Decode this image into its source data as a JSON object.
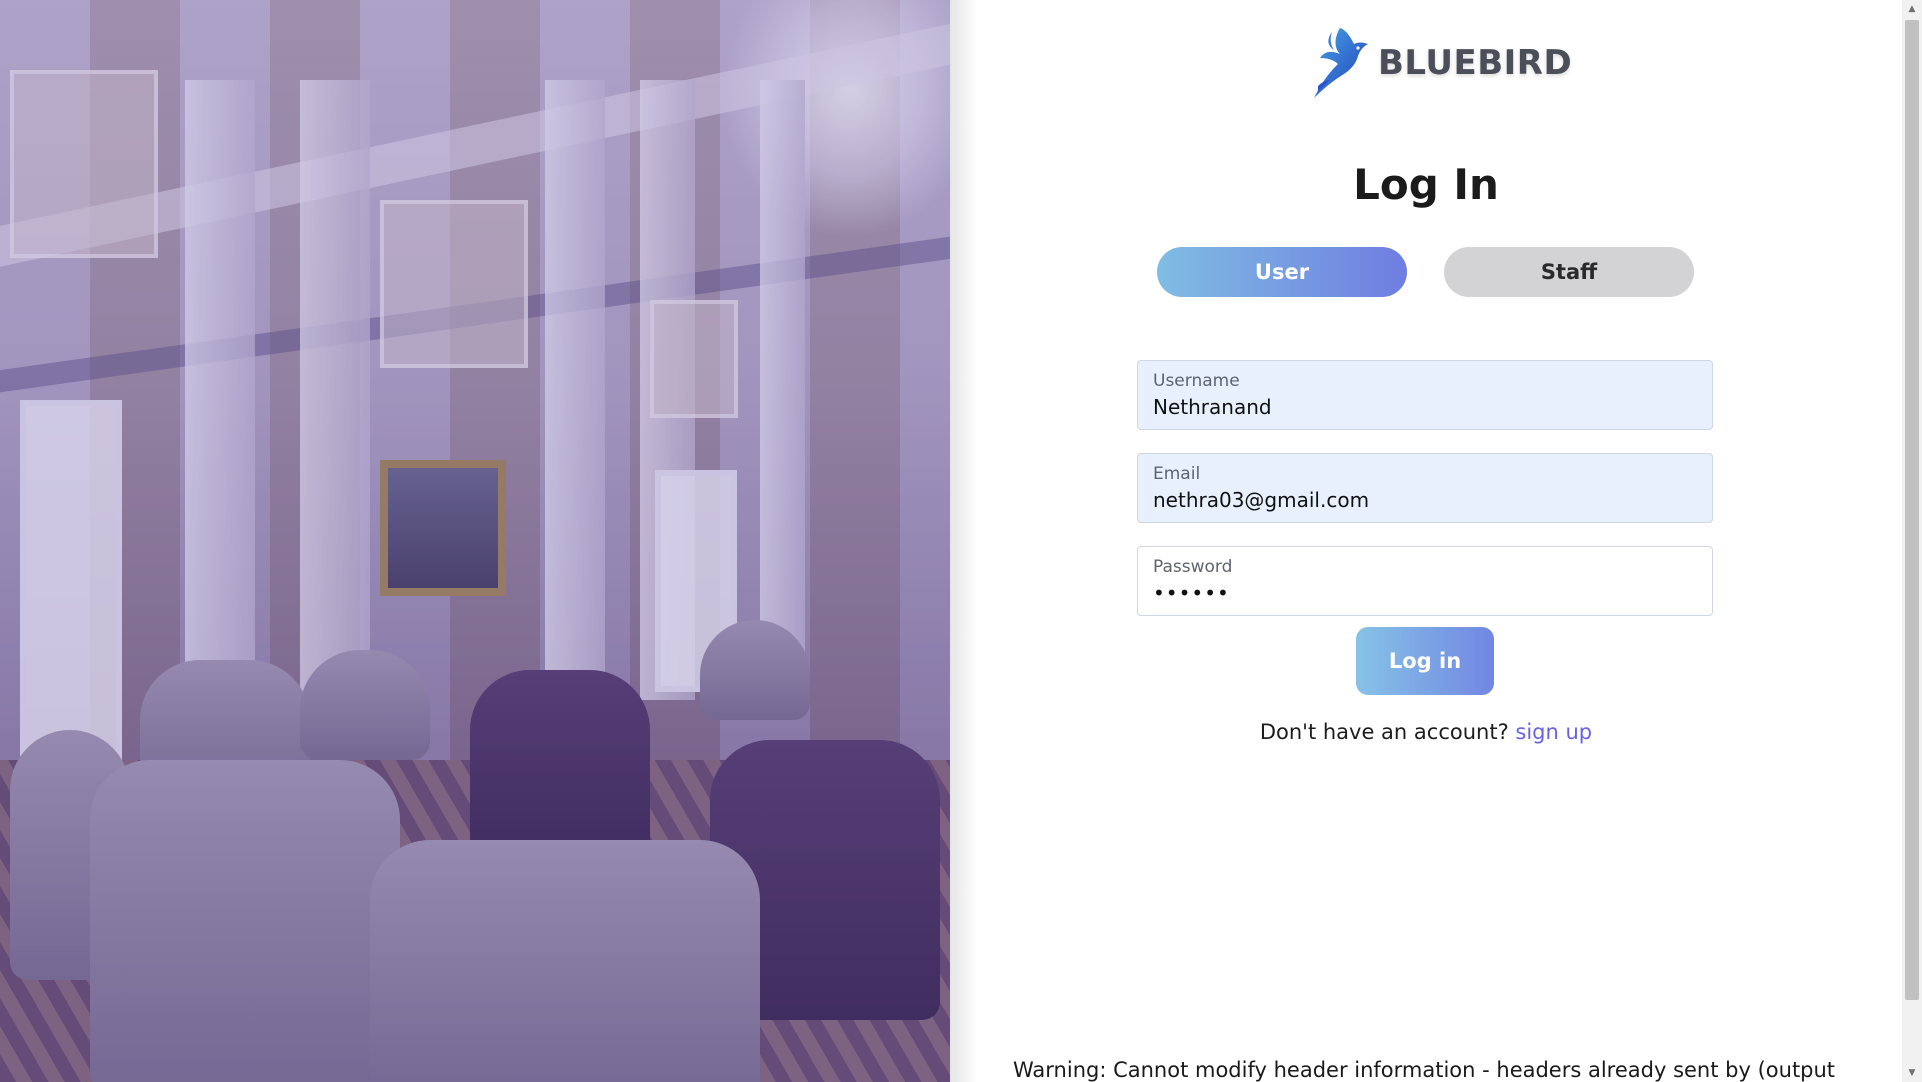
{
  "brand": {
    "name": "BLUEBIRD",
    "icon": "bluebird-logo-icon"
  },
  "login": {
    "title": "Log In",
    "roles": {
      "user_label": "User",
      "staff_label": "Staff",
      "selected": "User"
    },
    "fields": {
      "username": {
        "label": "Username",
        "value": "Nethranand"
      },
      "email": {
        "label": "Email",
        "value": "nethra03@gmail.com"
      },
      "password": {
        "label": "Password",
        "value": "••••••"
      }
    },
    "submit_label": "Log in",
    "signup_prompt": "Don't have an account?",
    "signup_link": "sign up"
  },
  "warning": {
    "text": "Warning: Cannot modify header information - headers already sent by (output"
  },
  "colors": {
    "accent_gradient_start": "#7fbde3",
    "accent_gradient_end": "#6f7de0",
    "link": "#6a62e0",
    "field_filled_bg": "#e8f0fd",
    "staff_button_bg": "#d3d3d6"
  },
  "scrollbar": {
    "up_icon": "scroll-up-arrow-icon",
    "down_icon": "scroll-down-arrow-icon"
  }
}
